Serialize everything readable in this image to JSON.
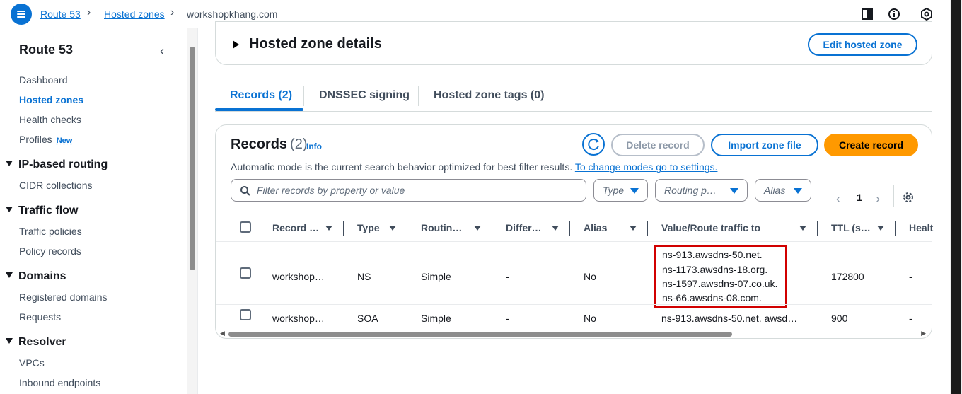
{
  "topbar": {
    "breadcrumbs": [
      "Route 53",
      "Hosted zones",
      "workshopkhang.com"
    ],
    "icons": [
      "menu-icon",
      "split-panel-icon",
      "info-icon",
      "settings-gear-icon"
    ]
  },
  "sidebar": {
    "title": "Route 53",
    "items": [
      {
        "label": "Dashboard"
      },
      {
        "label": "Hosted zones",
        "active": true
      },
      {
        "label": "Health checks"
      },
      {
        "label": "Profiles",
        "badge": "New"
      }
    ],
    "sections": [
      {
        "title": "IP-based routing",
        "items": [
          "CIDR collections"
        ]
      },
      {
        "title": "Traffic flow",
        "items": [
          "Traffic policies",
          "Policy records"
        ]
      },
      {
        "title": "Domains",
        "items": [
          "Registered domains",
          "Requests"
        ]
      },
      {
        "title": "Resolver",
        "items": [
          "VPCs",
          "Inbound endpoints"
        ]
      }
    ]
  },
  "hosted_zone_details": {
    "title": "Hosted zone details",
    "edit_button": "Edit hosted zone"
  },
  "tabs": [
    "Records (2)",
    "DNSSEC signing",
    "Hosted zone tags (0)"
  ],
  "records": {
    "title": "Records",
    "count": "(2)",
    "info": "Info",
    "description": "Automatic mode is the current search behavior optimized for best filter results.",
    "description_link": "To change modes go to settings.",
    "delete_button": "Delete record",
    "import_button": "Import zone file",
    "create_button": "Create record",
    "search_placeholder": "Filter records by property or value",
    "filters": [
      "Type",
      "Routing p…",
      "Alias"
    ],
    "page": "1",
    "columns": [
      "Record …",
      "Type",
      "Routin…",
      "Differ…",
      "Alias",
      "Value/Route traffic to",
      "TTL (s…",
      "Healt"
    ],
    "rows": [
      {
        "name": "workshop…",
        "type": "NS",
        "routing": "Simple",
        "differ": "-",
        "alias": "No",
        "values": [
          "ns-913.awsdns-50.net.",
          "ns-1173.awsdns-18.org.",
          "ns-1597.awsdns-07.co.uk.",
          "ns-66.awsdns-08.com."
        ],
        "ttl": "172800",
        "health": "-"
      },
      {
        "name": "workshop…",
        "type": "SOA",
        "routing": "Simple",
        "differ": "-",
        "alias": "No",
        "value": "ns-913.awsdns-50.net. awsd…",
        "ttl": "900",
        "health": "-"
      }
    ]
  },
  "colors": {
    "accent": "#0972d3",
    "primary_button": "#ff9900",
    "highlight_box": "#d10000"
  }
}
